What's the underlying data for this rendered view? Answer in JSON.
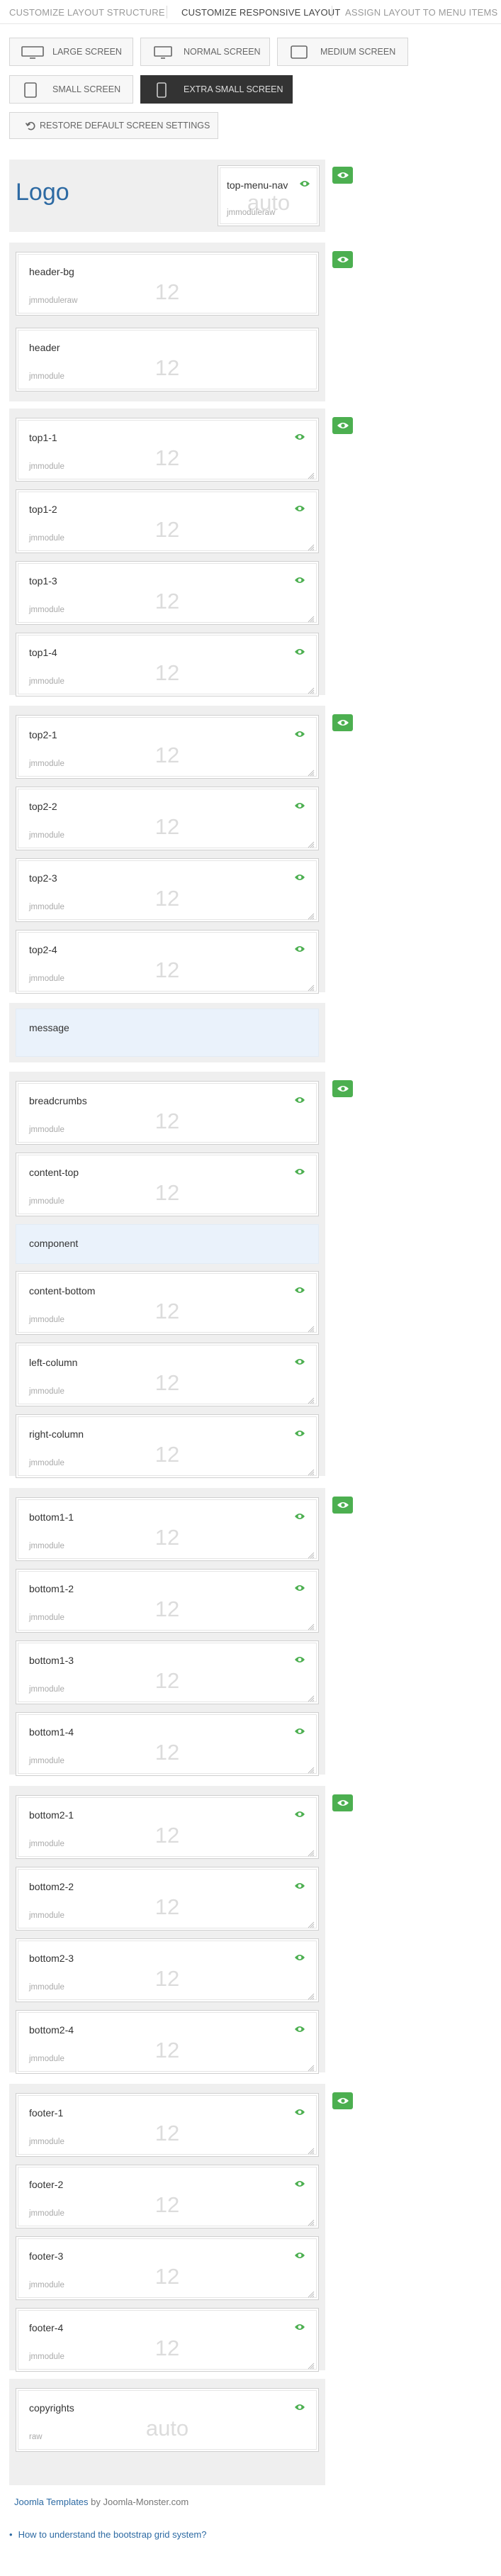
{
  "tabs": [
    {
      "label": "CUSTOMIZE LAYOUT STRUCTURE"
    },
    {
      "label": "CUSTOMIZE RESPONSIVE LAYOUT"
    },
    {
      "label": "ASSIGN LAYOUT TO MENU ITEMS"
    }
  ],
  "screens": [
    {
      "label": "LARGE SCREEN",
      "icon": "desktop-icon"
    },
    {
      "label": "NORMAL SCREEN",
      "icon": "monitor-icon"
    },
    {
      "label": "MEDIUM SCREEN",
      "icon": "tablet-landscape-icon"
    },
    {
      "label": "SMALL SCREEN",
      "icon": "tablet-portrait-icon"
    },
    {
      "label": "EXTRA SMALL SCREEN",
      "icon": "phone-icon",
      "active": true
    }
  ],
  "restore_label": "RESTORE DEFAULT SCREEN SETTINGS",
  "logo": {
    "text": "Logo"
  },
  "topnav": {
    "name": "top-menu-nav",
    "span": "auto",
    "style": "jmmoduleraw"
  },
  "header_row": [
    {
      "name": "header-bg",
      "span": "12",
      "style": "jmmoduleraw"
    },
    {
      "name": "header",
      "span": "12",
      "style": "jmmodule"
    }
  ],
  "top1": [
    {
      "name": "top1-1",
      "span": "12",
      "style": "jmmodule"
    },
    {
      "name": "top1-2",
      "span": "12",
      "style": "jmmodule"
    },
    {
      "name": "top1-3",
      "span": "12",
      "style": "jmmodule"
    },
    {
      "name": "top1-4",
      "span": "12",
      "style": "jmmodule"
    }
  ],
  "top2": [
    {
      "name": "top2-1",
      "span": "12",
      "style": "jmmodule"
    },
    {
      "name": "top2-2",
      "span": "12",
      "style": "jmmodule"
    },
    {
      "name": "top2-3",
      "span": "12",
      "style": "jmmodule"
    },
    {
      "name": "top2-4",
      "span": "12",
      "style": "jmmodule"
    }
  ],
  "message": {
    "name": "message"
  },
  "main": [
    {
      "name": "breadcrumbs",
      "span": "12",
      "style": "jmmodule"
    },
    {
      "name": "content-top",
      "span": "12",
      "style": "jmmodule"
    },
    {
      "name": "component"
    },
    {
      "name": "content-bottom",
      "span": "12",
      "style": "jmmodule"
    },
    {
      "name": "left-column",
      "span": "12",
      "style": "jmmodule"
    },
    {
      "name": "right-column",
      "span": "12",
      "style": "jmmodule"
    }
  ],
  "bottom1": [
    {
      "name": "bottom1-1",
      "span": "12",
      "style": "jmmodule"
    },
    {
      "name": "bottom1-2",
      "span": "12",
      "style": "jmmodule"
    },
    {
      "name": "bottom1-3",
      "span": "12",
      "style": "jmmodule"
    },
    {
      "name": "bottom1-4",
      "span": "12",
      "style": "jmmodule"
    }
  ],
  "bottom2": [
    {
      "name": "bottom2-1",
      "span": "12",
      "style": "jmmodule"
    },
    {
      "name": "bottom2-2",
      "span": "12",
      "style": "jmmodule"
    },
    {
      "name": "bottom2-3",
      "span": "12",
      "style": "jmmodule"
    },
    {
      "name": "bottom2-4",
      "span": "12",
      "style": "jmmodule"
    }
  ],
  "footer": [
    {
      "name": "footer-1",
      "span": "12",
      "style": "jmmodule"
    },
    {
      "name": "footer-2",
      "span": "12",
      "style": "jmmodule"
    },
    {
      "name": "footer-3",
      "span": "12",
      "style": "jmmodule"
    },
    {
      "name": "footer-4",
      "span": "12",
      "style": "jmmodule"
    }
  ],
  "copyrights": {
    "name": "copyrights",
    "span": "auto",
    "style": "raw"
  },
  "credit": {
    "link": "Joomla Templates",
    "by": " by Joomla-Monster.com"
  },
  "help_link": "How to understand the bootstrap grid system?",
  "colors": {
    "accent_green": "#4caf50",
    "logo_blue": "#2d6aa3",
    "active_tab_bg": "#333333",
    "row_bg": "#efefef",
    "plain_bg": "#eaf2fb"
  }
}
